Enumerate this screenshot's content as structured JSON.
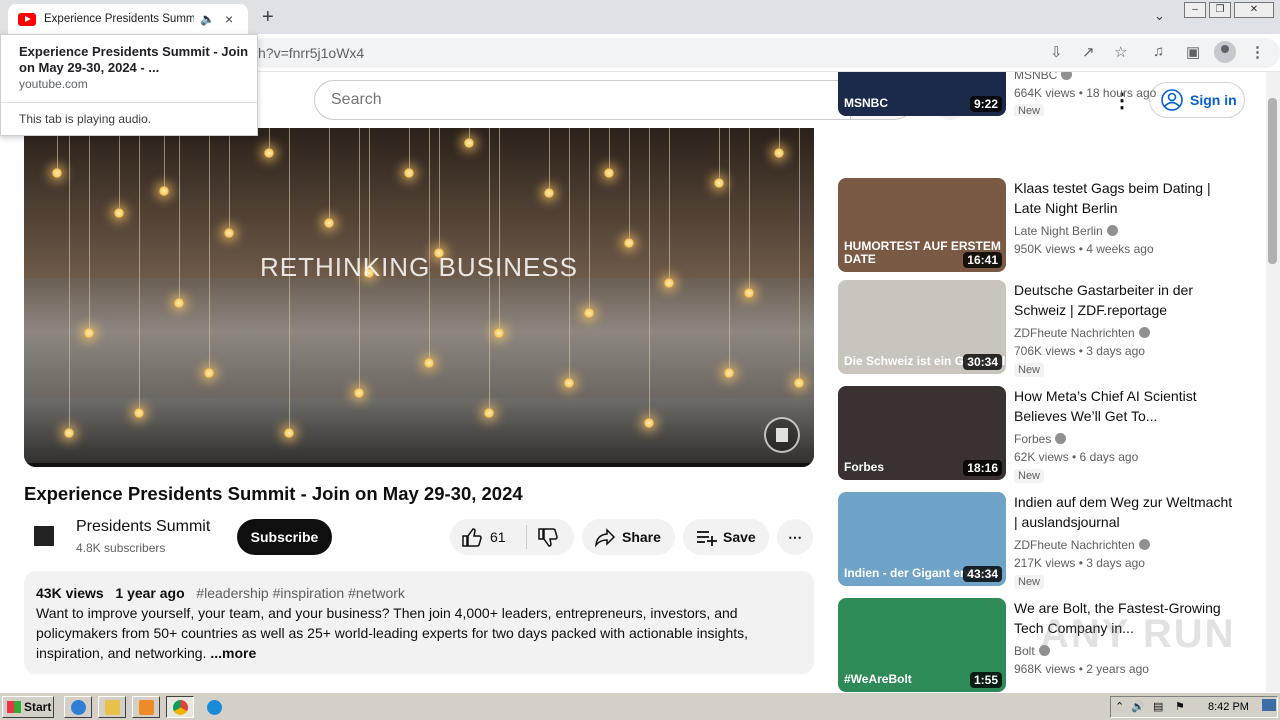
{
  "browser": {
    "tab": {
      "title": "Experience Presidents Summit - Join on May 29-30, 2024",
      "audio_icon": "speaker-icon",
      "close_glyph": "×"
    },
    "new_tab_glyph": "+",
    "address": "h?v=fnrr5j1oWx4",
    "hover_card": {
      "title": "Experience Presidents Summit - Join on May 29-30, 2024 - ...",
      "domain": "youtube.com",
      "audio_status": "This tab is playing audio."
    }
  },
  "youtube": {
    "search_placeholder": "Search",
    "signin_label": "Sign in",
    "accent_color": "#065fd4",
    "brand_color": "#ff0000"
  },
  "player": {
    "overlay_text": "RETHINKING BUSINESS"
  },
  "video": {
    "title": "Experience Presidents Summit - Join on May 29-30, 2024",
    "channel_name": "Presidents Summit",
    "subscribers": "4.8K subscribers",
    "subscribe_label": "Subscribe",
    "likes": "61",
    "share_label": "Share",
    "save_label": "Save",
    "more_glyph": "⋯",
    "description": {
      "views": "43K views",
      "age": "1 year ago",
      "tags": "#leadership #inspiration #network",
      "text": "Want to improve yourself, your team, and your business? Then join 4,000+ leaders, entrepreneurs, investors, and policymakers from 50+ countries as well as 25+ world-leading experts for two days packed with actionable insights, inspiration, and networking.",
      "more_label": "...more"
    }
  },
  "recommendations": [
    {
      "title": "",
      "channel": "MSNBC",
      "stats": "664K views • 18 hours ago",
      "badge": "New",
      "duration": "9:22",
      "thumb_text": "MSNBC",
      "thumb_color": "#1b2a4a"
    },
    {
      "title": "Klaas testet Gags beim Dating | Late Night Berlin",
      "channel": "Late Night Berlin",
      "stats": "950K views • 4 weeks ago",
      "badge": "",
      "duration": "16:41",
      "thumb_text": "HUMORTEST AUF ERSTEM DATE",
      "thumb_color": "#7a5a44"
    },
    {
      "title": "Deutsche Gastarbeiter in der Schweiz | ZDF.reportage",
      "channel": "ZDFheute Nachrichten",
      "stats": "706K views • 3 days ago",
      "badge": "New",
      "duration": "30:34",
      "thumb_text": "Die Schweiz ist ein Goldesel",
      "thumb_color": "#c9c4bd"
    },
    {
      "title": "How Meta’s Chief AI Scientist Believes We’ll Get To...",
      "channel": "Forbes",
      "stats": "62K views • 6 days ago",
      "badge": "New",
      "duration": "18:16",
      "thumb_text": "Forbes",
      "thumb_color": "#3a3230"
    },
    {
      "title": "Indien auf dem Weg zur Weltmacht | auslandsjournal",
      "channel": "ZDFheute Nachrichten",
      "stats": "217K views • 3 days ago",
      "badge": "New",
      "duration": "43:34",
      "thumb_text": "Indien - der Gigant erwacht",
      "thumb_color": "#6fa3c7"
    },
    {
      "title": "We are Bolt, the Fastest-Growing Tech Company in...",
      "channel": "Bolt",
      "stats": "968K views • 2 years ago",
      "badge": "",
      "duration": "1:55",
      "thumb_text": "#WeAreBolt",
      "thumb_color": "#2e8a57"
    }
  ],
  "watermark": "ANY RUN",
  "taskbar": {
    "start_label": "Start",
    "clock": "8:42 PM"
  }
}
